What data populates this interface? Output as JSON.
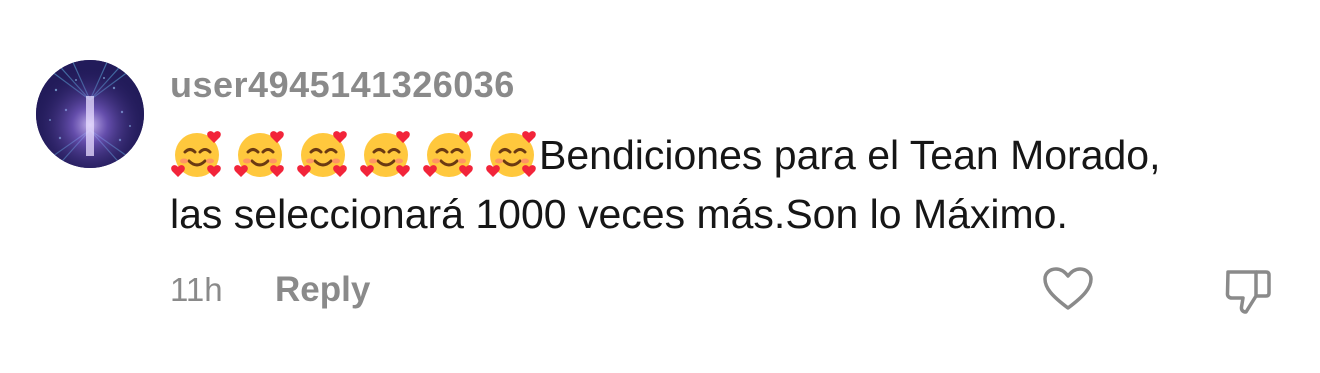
{
  "comment": {
    "username": "user4945141326036",
    "emoji_icon": "smiling-face-with-hearts",
    "emoji_count": 6,
    "text_line1": "Bendiciones para el Tean Morado,",
    "text_line2": "las seleccionará 1000 veces más.Son lo Máximo.",
    "time": "11h",
    "reply_label": "Reply",
    "like_icon": "heart-outline-icon",
    "dislike_icon": "thumbs-down-outline-icon"
  },
  "colors": {
    "meta_gray": "#8a8a8a",
    "text": "#161616",
    "icon_gray": "#8a8a8a"
  }
}
